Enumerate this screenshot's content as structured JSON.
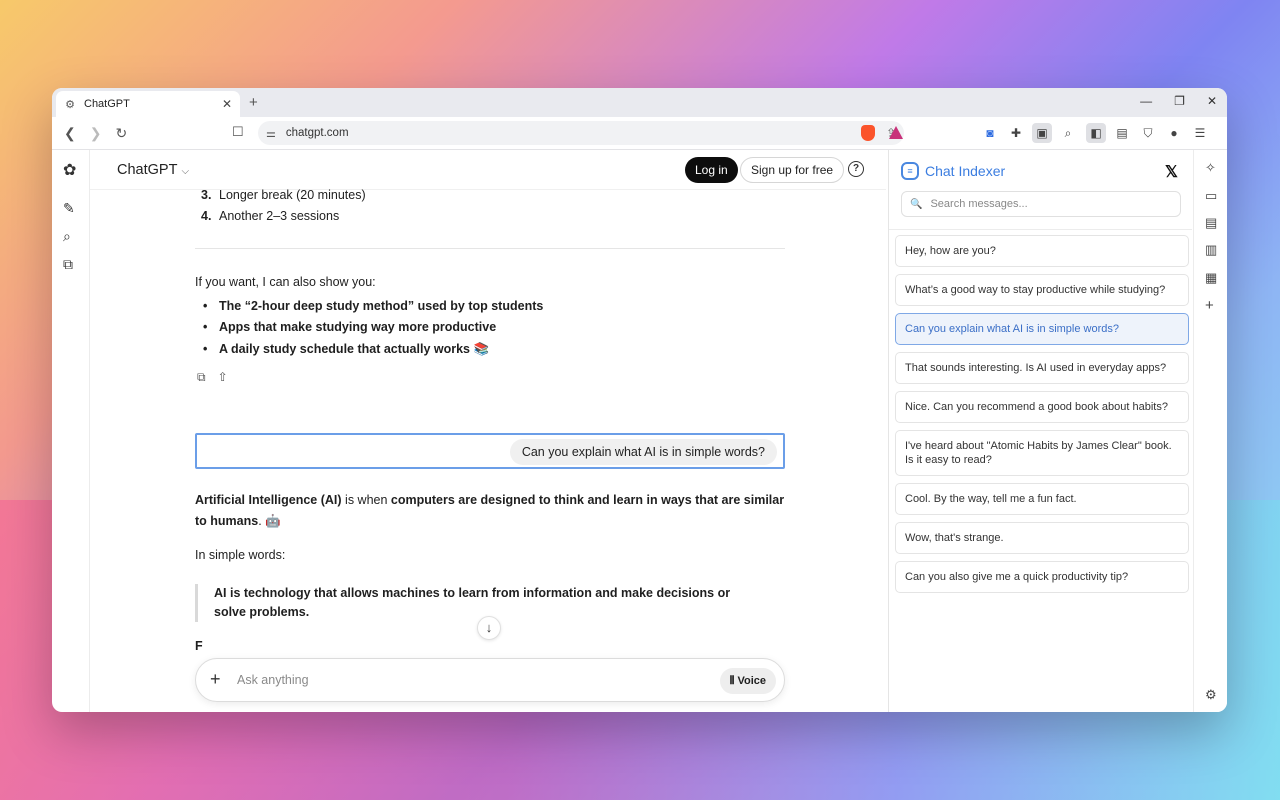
{
  "browser": {
    "tab_title": "ChatGPT",
    "tab_close": "✕",
    "new_tab": "+",
    "url": "chatgpt.com",
    "window_controls": [
      "—",
      "❐",
      "✕"
    ]
  },
  "chatgpt": {
    "brand": "ChatGPT",
    "login": "Log in",
    "signup": "Sign up for free",
    "help": "?",
    "list_items": [
      {
        "num": "3.",
        "text": "Longer break (20 minutes)"
      },
      {
        "num": "4.",
        "text": "Another 2–3 sessions"
      }
    ],
    "offer_intro": "If you want, I can also show you:",
    "offers": [
      "The “2-hour deep study method” used by top students",
      "Apps that make studying way more productive",
      "A daily study schedule that actually works 📚"
    ],
    "user_message": "Can you explain what AI is in simple words?",
    "answer_bold1": "Artificial Intelligence (AI)",
    "answer_mid": " is when ",
    "answer_bold2": "computers are designed to think and learn in ways that are similar to humans",
    "answer_end": ". 🤖",
    "simple_label": "In simple words:",
    "quote": "AI is technology that allows machines to learn from information and make decisions or solve problems.",
    "partial": "F",
    "composer_placeholder": "Ask anything",
    "voice_label": "Voice"
  },
  "panel": {
    "title": "Chat Indexer",
    "search_placeholder": "Search messages...",
    "items": [
      "Hey, how are you?",
      "What’s a good way to stay productive while studying?",
      "Can you explain what AI is in simple words?",
      "That sounds interesting. Is AI used in everyday apps?",
      "Nice. Can you recommend a good book about habits?",
      "I've heard about \"Atomic Habits by James Clear\" book. Is it easy to read?",
      "Cool. By the way, tell me a fun fact.",
      "Wow, that's strange.",
      "Can you also give me a quick productivity tip?"
    ],
    "active_index": 2
  },
  "colors": {
    "accent": "#3b7de0",
    "highlight_border": "#6b9ee8"
  }
}
